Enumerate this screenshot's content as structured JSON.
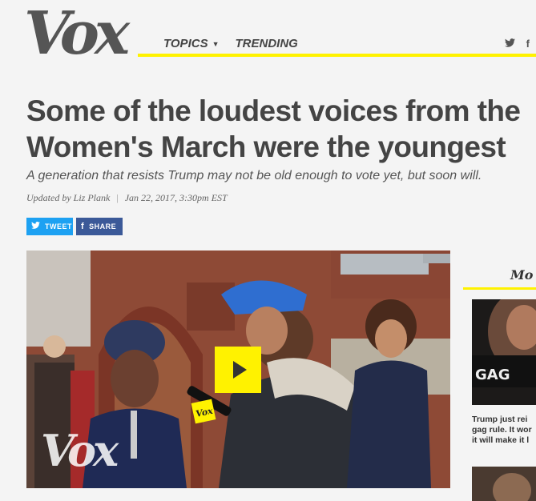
{
  "header": {
    "logo": "Vox",
    "nav": [
      {
        "label": "TOPICS",
        "has_dropdown": true
      },
      {
        "label": "TRENDING",
        "has_dropdown": false
      }
    ],
    "social_icons": [
      "twitter-icon",
      "facebook-icon"
    ],
    "accent_color": "#fff200"
  },
  "article": {
    "headline": "Some of the loudest voices from the Women's March were the youngest",
    "dek": "A generation that resists Trump may not be old enough to vote yet, but soon will.",
    "byline": {
      "author": "Updated by Liz Plank",
      "date": "Jan 22, 2017, 3:30pm EST"
    },
    "share": {
      "tweet_label": "TWEET",
      "share_label": "SHARE"
    },
    "video": {
      "watermark": "Vox",
      "mic_flag": "Vox",
      "play_icon": "play-icon"
    }
  },
  "sidebar": {
    "title": "Mo",
    "items": [
      {
        "text": "Trump just rei\ngag rule. It wor\nit will make it l",
        "thumb_text": "GAG"
      }
    ]
  }
}
